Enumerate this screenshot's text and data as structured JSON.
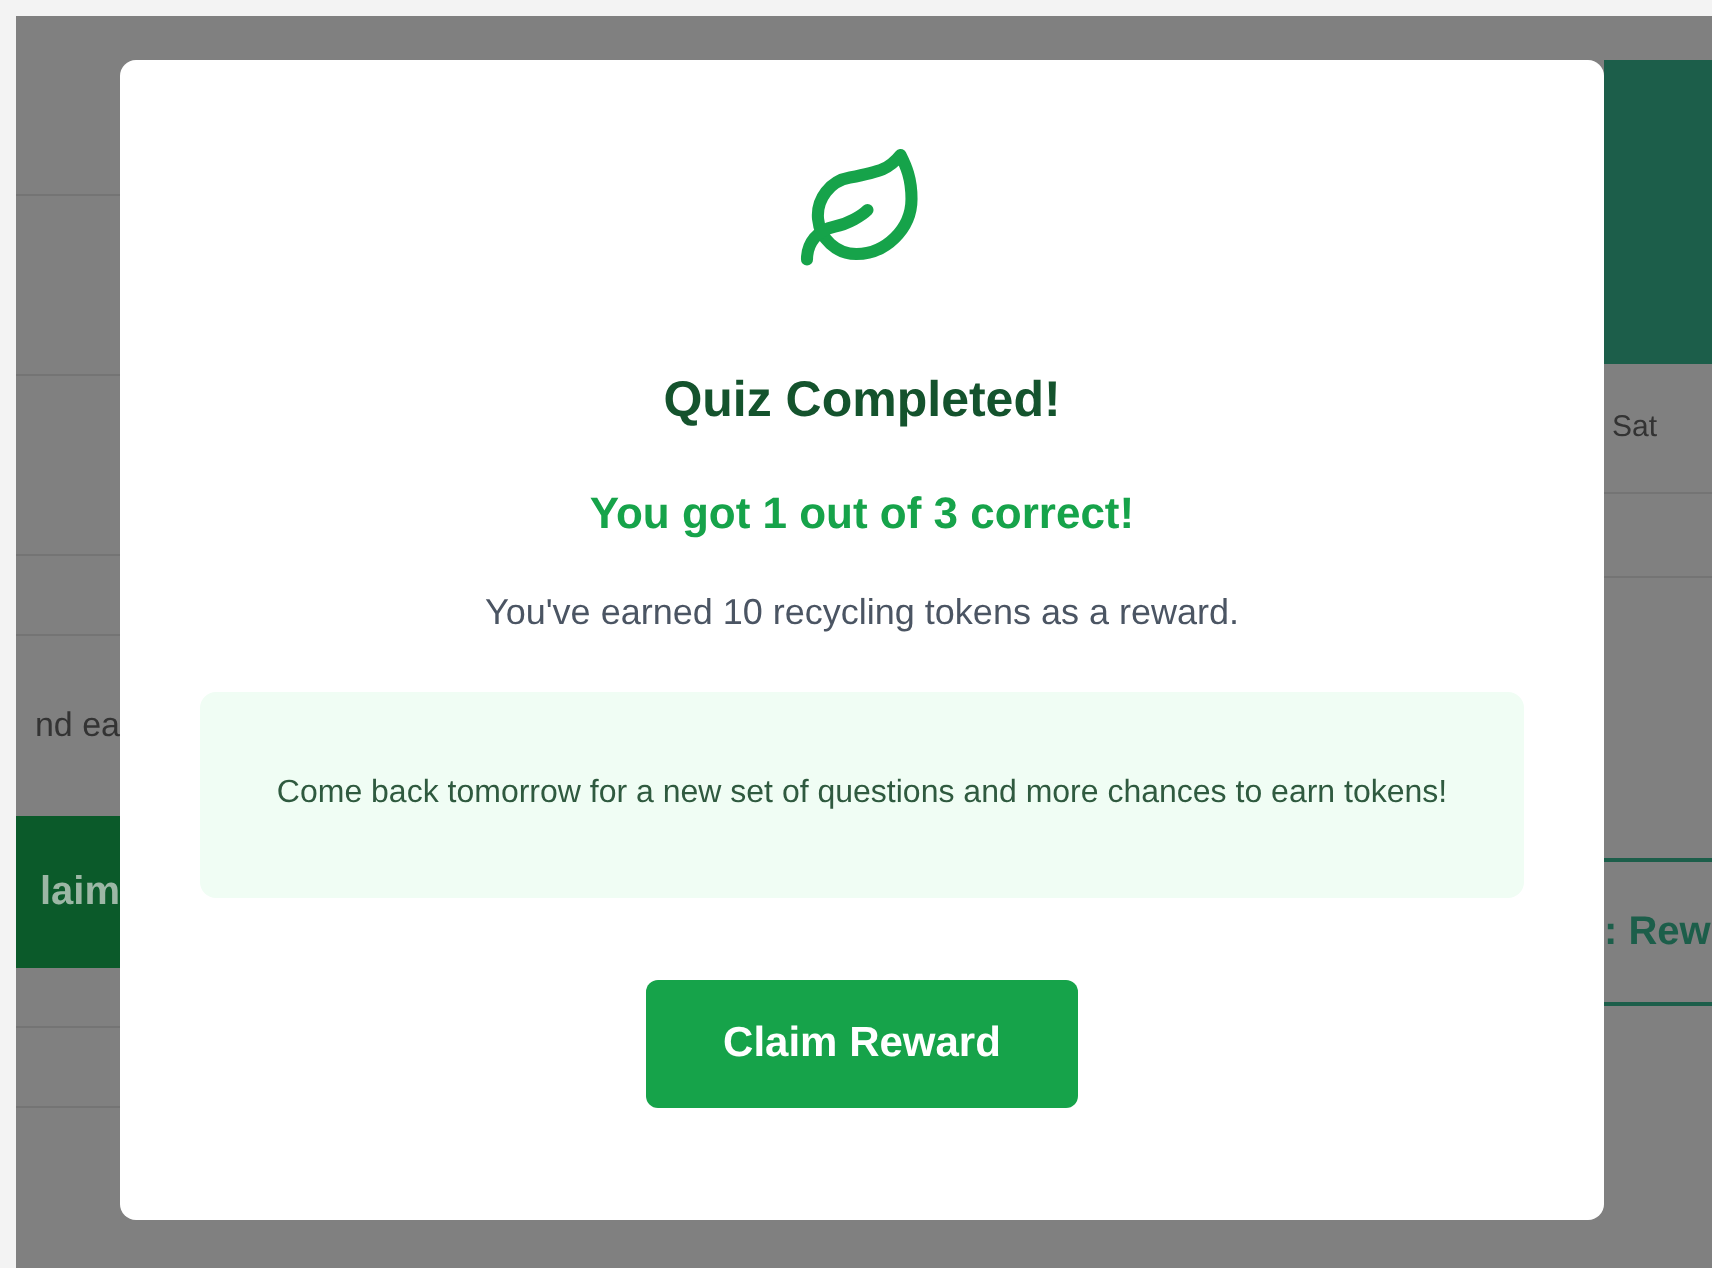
{
  "background": {
    "left_text": "nd ea",
    "left_button": "laim",
    "right_day": "Sat",
    "right_button": ": Rew"
  },
  "modal": {
    "title": "Quiz Completed!",
    "score": "You got 1 out of 3 correct!",
    "reward_text": "You've earned 10 recycling tokens as a reward.",
    "note": "Come back tomorrow for a new set of questions and more chances to earn tokens!",
    "button": "Claim Reward"
  }
}
